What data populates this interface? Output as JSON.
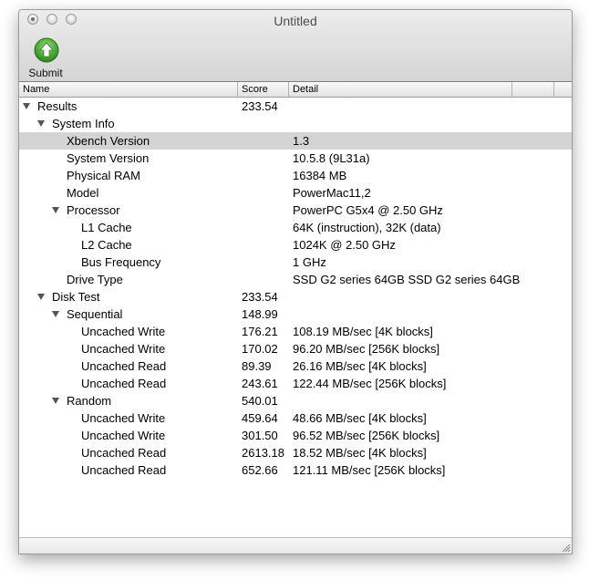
{
  "window": {
    "title": "Untitled"
  },
  "toolbar": {
    "submit_label": "Submit"
  },
  "columns": {
    "name": "Name",
    "score": "Score",
    "detail": "Detail"
  },
  "rows": [
    {
      "name": "Results",
      "score": "233.54",
      "detail": "",
      "level": 0,
      "expandable": true
    },
    {
      "name": "System Info",
      "score": "",
      "detail": "",
      "level": 1,
      "expandable": true
    },
    {
      "name": "Xbench Version",
      "score": "",
      "detail": "1.3",
      "level": 2,
      "expandable": false,
      "selected": true
    },
    {
      "name": "System Version",
      "score": "",
      "detail": "10.5.8 (9L31a)",
      "level": 2,
      "expandable": false
    },
    {
      "name": "Physical RAM",
      "score": "",
      "detail": "16384 MB",
      "level": 2,
      "expandable": false
    },
    {
      "name": "Model",
      "score": "",
      "detail": "PowerMac11,2",
      "level": 2,
      "expandable": false
    },
    {
      "name": "Processor",
      "score": "",
      "detail": "PowerPC G5x4 @ 2.50 GHz",
      "level": 2,
      "expandable": true
    },
    {
      "name": "L1 Cache",
      "score": "",
      "detail": "64K (instruction), 32K (data)",
      "level": 3,
      "expandable": false
    },
    {
      "name": "L2 Cache",
      "score": "",
      "detail": "1024K @ 2.50 GHz",
      "level": 3,
      "expandable": false
    },
    {
      "name": "Bus Frequency",
      "score": "",
      "detail": "1 GHz",
      "level": 3,
      "expandable": false
    },
    {
      "name": "Drive Type",
      "score": "",
      "detail": "SSD G2 series 64GB SSD G2 series 64GB",
      "level": 2,
      "expandable": false
    },
    {
      "name": "Disk Test",
      "score": "233.54",
      "detail": "",
      "level": 1,
      "expandable": true
    },
    {
      "name": "Sequential",
      "score": "148.99",
      "detail": "",
      "level": 2,
      "expandable": true
    },
    {
      "name": "Uncached Write",
      "score": "176.21",
      "detail": "108.19 MB/sec [4K blocks]",
      "level": 3,
      "expandable": false
    },
    {
      "name": "Uncached Write",
      "score": "170.02",
      "detail": "96.20 MB/sec [256K blocks]",
      "level": 3,
      "expandable": false
    },
    {
      "name": "Uncached Read",
      "score": "89.39",
      "detail": "26.16 MB/sec [4K blocks]",
      "level": 3,
      "expandable": false
    },
    {
      "name": "Uncached Read",
      "score": "243.61",
      "detail": "122.44 MB/sec [256K blocks]",
      "level": 3,
      "expandable": false
    },
    {
      "name": "Random",
      "score": "540.01",
      "detail": "",
      "level": 2,
      "expandable": true
    },
    {
      "name": "Uncached Write",
      "score": "459.64",
      "detail": "48.66 MB/sec [4K blocks]",
      "level": 3,
      "expandable": false
    },
    {
      "name": "Uncached Write",
      "score": "301.50",
      "detail": "96.52 MB/sec [256K blocks]",
      "level": 3,
      "expandable": false
    },
    {
      "name": "Uncached Read",
      "score": "2613.18",
      "detail": "18.52 MB/sec [4K blocks]",
      "level": 3,
      "expandable": false
    },
    {
      "name": "Uncached Read",
      "score": "652.66",
      "detail": "121.11 MB/sec [256K blocks]",
      "level": 3,
      "expandable": false
    }
  ],
  "icons": {
    "submit": "green-up-arrow-icon",
    "disclosure": "disclosure-triangle-icon",
    "resize": "resize-grip-icon"
  },
  "colors": {
    "selection": "#d4d4d4",
    "submit_green": "#3ea12a"
  }
}
